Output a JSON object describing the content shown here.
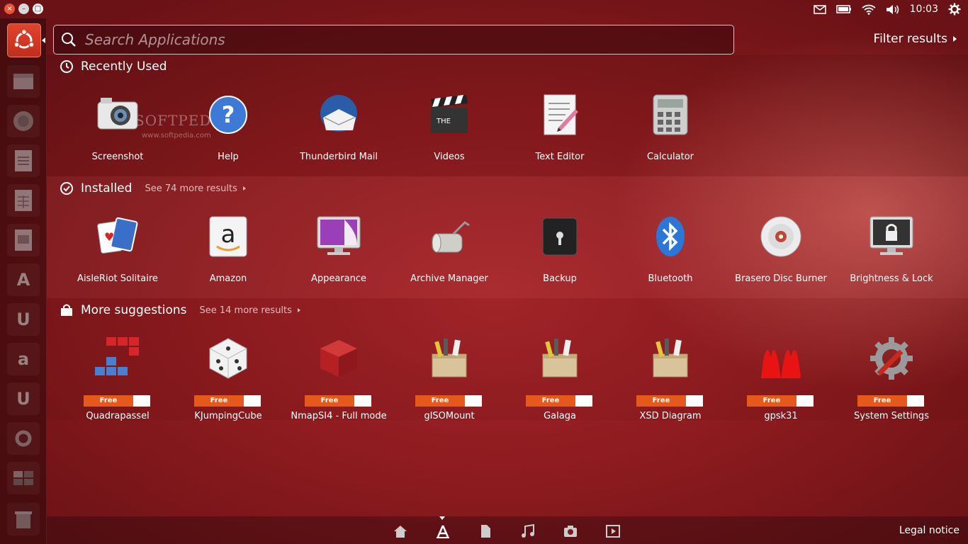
{
  "top_panel": {
    "window_buttons": [
      "×",
      "–",
      "□"
    ],
    "clock": "10:03",
    "indicator_icons": [
      "mail-icon",
      "battery-icon",
      "wifi-icon",
      "volume-icon",
      "clock",
      "gear-icon"
    ]
  },
  "launcher": {
    "items": [
      "ubuntu-home",
      "file-manager",
      "firefox",
      "libreoffice-writer",
      "libreoffice-calc",
      "libreoffice-impress",
      "ubuntu-software-center",
      "ubuntu-one",
      "amazon",
      "ubuntu-one-music",
      "system-settings",
      "workspace-switcher",
      "trash"
    ]
  },
  "search": {
    "placeholder": "Search Applications",
    "filter_label": "Filter results"
  },
  "watermark": {
    "text": "SOFTPEDIA",
    "url": "www.softpedia.com"
  },
  "sections": {
    "recent": {
      "title": "Recently Used",
      "apps": [
        {
          "label": "Screenshot",
          "icon": "camera-icon"
        },
        {
          "label": "Help",
          "icon": "help-icon"
        },
        {
          "label": "Thunderbird Mail",
          "icon": "thunderbird-icon"
        },
        {
          "label": "Videos",
          "icon": "clapperboard-icon"
        },
        {
          "label": "Text Editor",
          "icon": "text-editor-icon"
        },
        {
          "label": "Calculator",
          "icon": "calculator-icon"
        }
      ]
    },
    "installed": {
      "title": "Installed",
      "more": "See 74 more results",
      "apps": [
        {
          "label": "AisleRiot Solitaire",
          "icon": "cards-icon"
        },
        {
          "label": "Amazon",
          "icon": "amazon-icon"
        },
        {
          "label": "Appearance",
          "icon": "monitor-icon"
        },
        {
          "label": "Archive Manager",
          "icon": "archive-icon"
        },
        {
          "label": "Backup",
          "icon": "safe-icon"
        },
        {
          "label": "Bluetooth",
          "icon": "bluetooth-icon"
        },
        {
          "label": "Brasero Disc Burner",
          "icon": "disc-icon"
        },
        {
          "label": "Brightness & Lock",
          "icon": "lock-monitor-icon"
        }
      ]
    },
    "suggestions": {
      "title": "More suggestions",
      "more": "See 14 more results",
      "badge": "Free",
      "apps": [
        {
          "label": "Quadrapassel",
          "icon": "blocks-icon"
        },
        {
          "label": "KJumpingCube",
          "icon": "dice-icon"
        },
        {
          "label": "NmapSI4 - Full mode",
          "icon": "red-cube-icon"
        },
        {
          "label": "gISOMount",
          "icon": "package-icon"
        },
        {
          "label": "Galaga",
          "icon": "package-icon"
        },
        {
          "label": "XSD Diagram",
          "icon": "package-icon"
        },
        {
          "label": "gpsk31",
          "icon": "waveform-icon"
        },
        {
          "label": "System Settings",
          "icon": "settings-gear-icon"
        }
      ]
    }
  },
  "lenses": [
    "home-lens",
    "applications-lens",
    "files-lens",
    "music-lens",
    "photos-lens",
    "video-lens"
  ],
  "legal": "Legal notice",
  "colors": {
    "accent": "#e55a1c",
    "launcher_home": "#d63c26"
  }
}
